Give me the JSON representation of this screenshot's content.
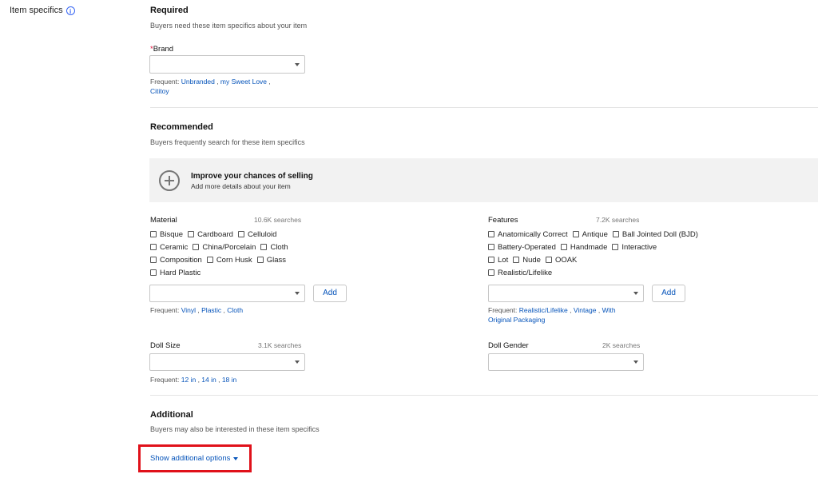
{
  "left_label": "Item specifics",
  "required": {
    "title": "Required",
    "subtitle": "Buyers need these item specifics about your item",
    "brand": {
      "label": "Brand",
      "value": "",
      "frequent_label": "Frequent:",
      "frequent": [
        "Unbranded",
        "my Sweet Love",
        "Cititoy"
      ]
    }
  },
  "recommended": {
    "title": "Recommended",
    "subtitle": "Buyers frequently search for these item specifics",
    "improve_title": "Improve your chances of selling",
    "improve_sub": "Add more details about your item",
    "material": {
      "label": "Material",
      "count": "10.6K searches",
      "options": [
        [
          "Bisque",
          "Cardboard",
          "Celluloid"
        ],
        [
          "Ceramic",
          "China/Porcelain",
          "Cloth"
        ],
        [
          "Composition",
          "Corn Husk",
          "Glass"
        ],
        [
          "Hard Plastic"
        ]
      ],
      "add_label": "Add",
      "frequent_label": "Frequent:",
      "frequent": [
        "Vinyl",
        "Plastic",
        "Cloth"
      ]
    },
    "features": {
      "label": "Features",
      "count": "7.2K searches",
      "options": [
        [
          "Anatomically Correct",
          "Antique",
          "Ball Jointed Doll (BJD)"
        ],
        [
          "Battery-Operated",
          "Handmade",
          "Interactive"
        ],
        [
          "Lot",
          "Nude",
          "OOAK"
        ],
        [
          "Realistic/Lifelike"
        ]
      ],
      "add_label": "Add",
      "frequent_label": "Frequent:",
      "frequent": [
        "Realistic/Lifelike",
        "Vintage",
        "With Original Packaging"
      ]
    },
    "doll_size": {
      "label": "Doll Size",
      "count": "3.1K searches",
      "frequent_label": "Frequent:",
      "frequent": [
        "12 in",
        "14 in",
        "18 in"
      ]
    },
    "doll_gender": {
      "label": "Doll Gender",
      "count": "2K searches"
    }
  },
  "additional": {
    "title": "Additional",
    "subtitle": "Buyers may also be interested in these item specifics",
    "show_options": "Show additional options"
  },
  "colors": {
    "link": "#0654ba",
    "highlight": "#e0111a"
  }
}
